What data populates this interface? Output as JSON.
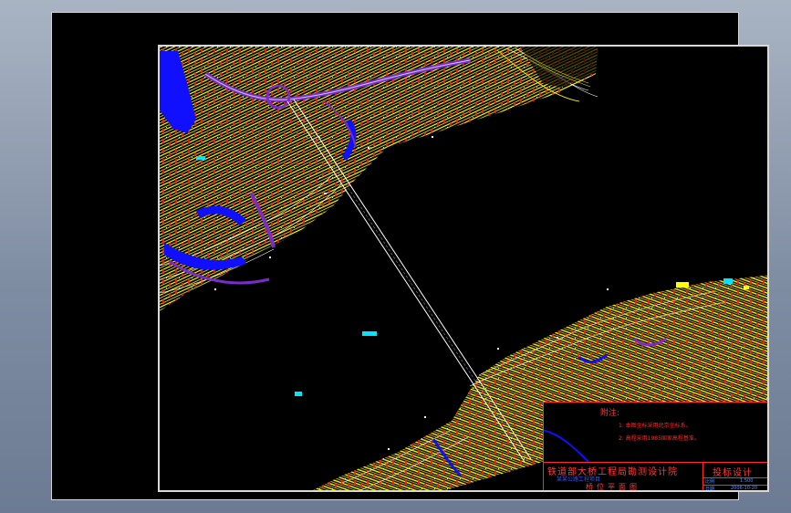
{
  "notes": {
    "title": "附注:",
    "lines": [
      "1. 本图坐标采用北京坐标系。",
      "2. 高程采用1985国家高程基准。"
    ]
  },
  "title_block": {
    "organization": "铁道部大桥工程局勘测设计院",
    "subtitle": "某某公路工程项目",
    "drawing_name": "桥位平面图",
    "stage": "投标设计",
    "scale_label": "比例",
    "scale_value": "1:500",
    "date_label": "日期",
    "date_value": "2006-10-20"
  },
  "colors": {
    "background": "#000000",
    "terrain": "#ffff00",
    "water": "#1010ff",
    "road": "#7a2cc8",
    "markers": "#ff1a1a",
    "bridge": "#ffffff",
    "cyan_labels": "#00e5ff"
  }
}
